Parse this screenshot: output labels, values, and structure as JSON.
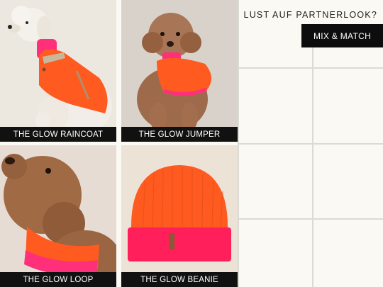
{
  "promo": {
    "headline": "LUST AUF PARTNERLOOK?",
    "cta_label": "MIX & MATCH"
  },
  "products": [
    {
      "name": "THE GLOW RAINCOAT"
    },
    {
      "name": "THE GLOW JUMPER"
    },
    {
      "name": "THE GLOW LOOP"
    },
    {
      "name": "THE GLOW BEANIE"
    }
  ],
  "colors": {
    "neon_orange": "#ff5a1f",
    "neon_pink": "#ff2f7a",
    "caption_bg": "#111111"
  }
}
